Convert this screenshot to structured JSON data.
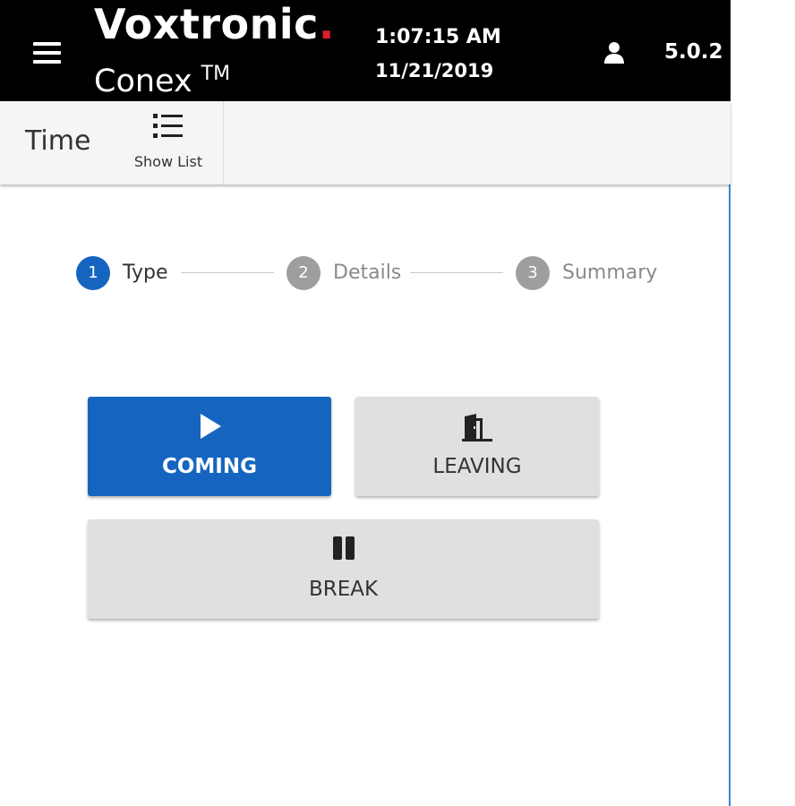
{
  "header": {
    "brand": "Voxtronic",
    "brand_dot": ".",
    "product": "Conex",
    "trademark": "TM",
    "time": "1:07:15 AM",
    "date": "11/21/2019",
    "version": "5.0.2",
    "icons": {
      "menu": "hamburger-menu-icon",
      "user": "user-icon"
    }
  },
  "toolbar": {
    "title": "Time",
    "show_list_label": "Show List",
    "show_list_icon": "list-icon"
  },
  "stepper": {
    "steps": [
      {
        "number": "1",
        "label": "Type",
        "active": true
      },
      {
        "number": "2",
        "label": "Details",
        "active": false
      },
      {
        "number": "3",
        "label": "Summary",
        "active": false
      }
    ]
  },
  "actions": {
    "coming": {
      "label": "COMING",
      "icon": "play-icon",
      "selected": true
    },
    "leaving": {
      "label": "LEAVING",
      "icon": "door-exit-icon",
      "selected": false
    },
    "break": {
      "label": "BREAK",
      "icon": "pause-icon",
      "selected": false
    }
  },
  "colors": {
    "header_bg": "#000000",
    "brand_accent": "#e01e2b",
    "primary": "#1565c0",
    "inactive_step": "#9e9e9e",
    "button_gray": "#e0e0e0"
  }
}
